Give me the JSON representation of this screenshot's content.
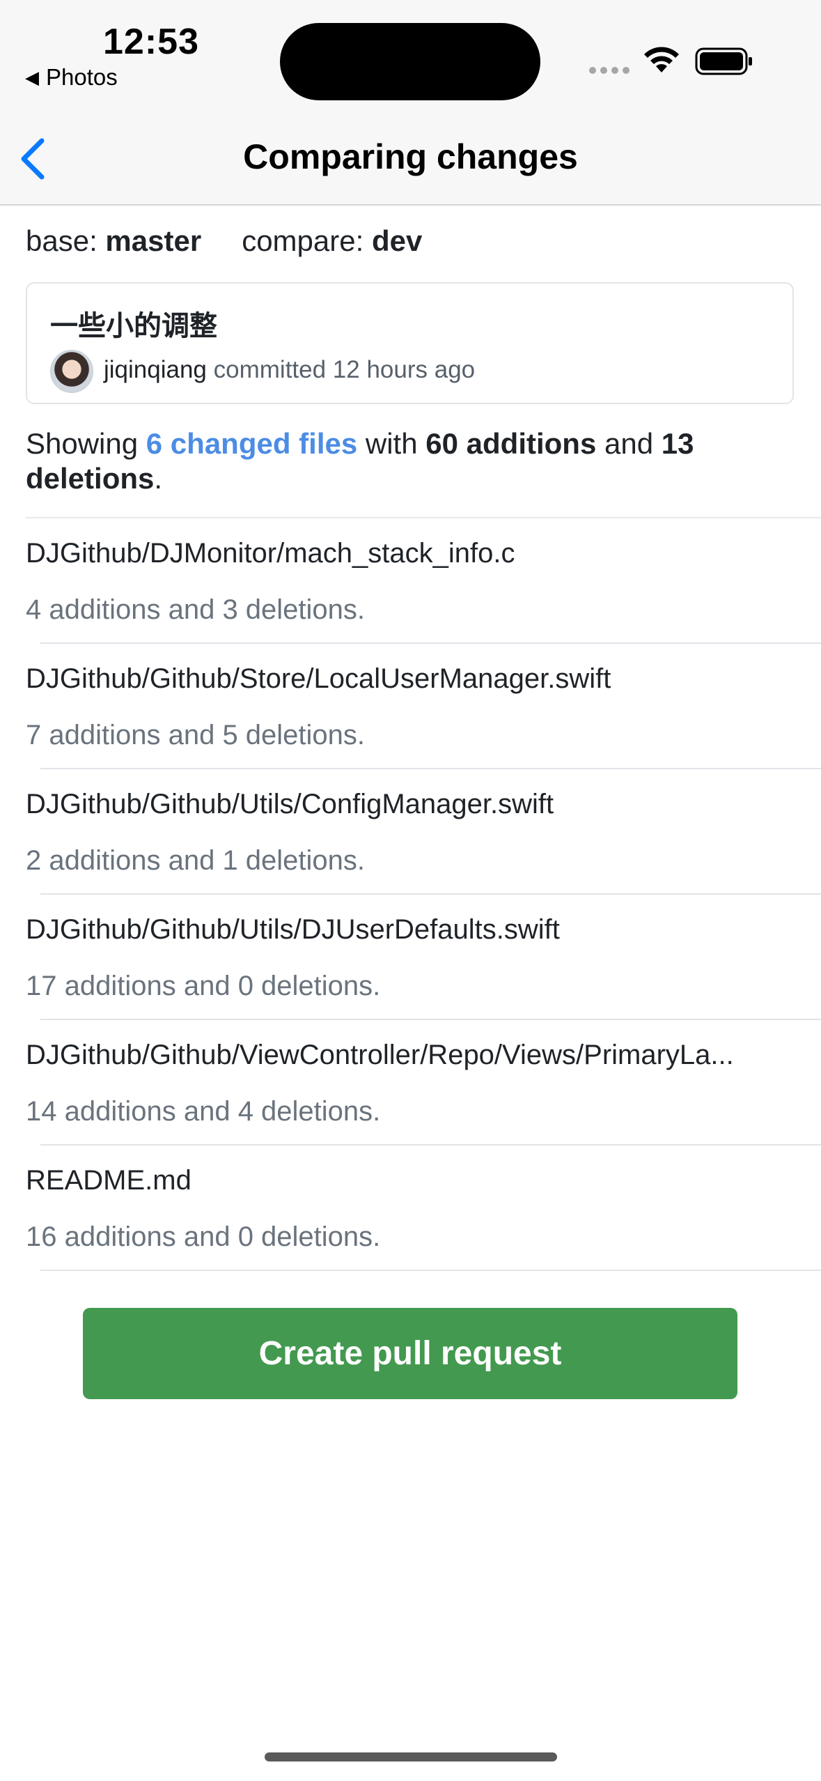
{
  "status_bar": {
    "time": "12:53",
    "back_app": "Photos",
    "icons": [
      "cellular-icon",
      "wifi-icon",
      "battery-icon"
    ]
  },
  "nav": {
    "title": "Comparing changes",
    "back_icon": "chevron-left-icon"
  },
  "branches": {
    "base_label": "base:",
    "base_value": "master",
    "compare_label": "compare:",
    "compare_value": "dev"
  },
  "commit": {
    "message": "一些小的调整",
    "author": "jiqinqiang",
    "meta": "committed 12 hours ago"
  },
  "summary": {
    "prefix": "Showing",
    "changed_files": "6 changed files",
    "middle": "with",
    "additions": "60 additions",
    "and": "and",
    "deletions": "13 deletions",
    "suffix": "."
  },
  "files": [
    {
      "path": "DJGithub/DJMonitor/mach_stack_info.c",
      "stats": "4 additions and 3 deletions."
    },
    {
      "path": "DJGithub/Github/Store/LocalUserManager.swift",
      "stats": "7 additions and 5 deletions."
    },
    {
      "path": "DJGithub/Github/Utils/ConfigManager.swift",
      "stats": "2 additions and 1 deletions."
    },
    {
      "path": "DJGithub/Github/Utils/DJUserDefaults.swift",
      "stats": "17 additions and 0 deletions."
    },
    {
      "path": "DJGithub/Github/ViewController/Repo/Views/PrimaryLa...",
      "stats": "14 additions and 4 deletions."
    },
    {
      "path": "README.md",
      "stats": "16 additions and 0 deletions."
    }
  ],
  "actions": {
    "create_pr_label": "Create pull request"
  },
  "colors": {
    "accent_link": "#4c8ce4",
    "button_green": "#43994f",
    "nav_blue": "#0a7aff"
  }
}
